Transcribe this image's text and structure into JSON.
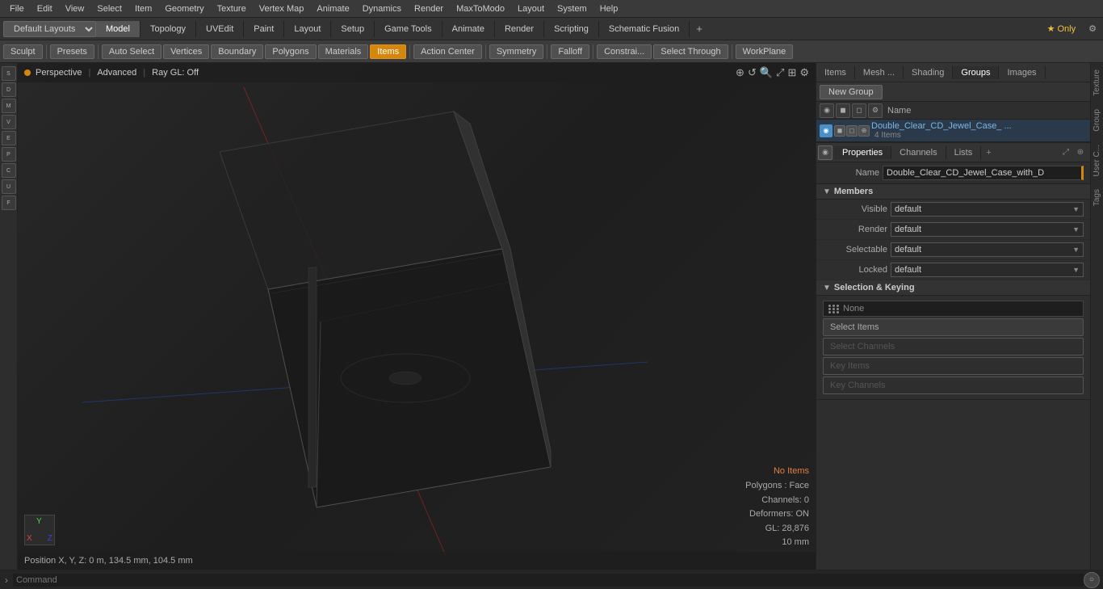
{
  "menu": {
    "items": [
      "File",
      "Edit",
      "View",
      "Select",
      "Item",
      "Geometry",
      "Texture",
      "Vertex Map",
      "Animate",
      "Dynamics",
      "Render",
      "MaxToModo",
      "Layout",
      "System",
      "Help"
    ]
  },
  "layout": {
    "dropdown_label": "Default Layouts ▾",
    "tabs": [
      "Model",
      "Topology",
      "UVEdit",
      "Paint",
      "Layout",
      "Setup",
      "Game Tools",
      "Animate",
      "Render",
      "Scripting",
      "Schematic Fusion"
    ],
    "active_tab": "Model",
    "star_label": "★ Only",
    "plus_label": "+"
  },
  "toolbar": {
    "sculpt_label": "Sculpt",
    "presets_label": "Presets",
    "auto_select_label": "Auto Select",
    "vertices_label": "Vertices",
    "boundary_label": "Boundary",
    "polygons_label": "Polygons",
    "materials_label": "Materials",
    "items_label": "Items",
    "action_center_label": "Action Center",
    "symmetry_label": "Symmetry",
    "falloff_label": "Falloff",
    "constrai_label": "Constrai...",
    "select_through_label": "Select Through",
    "workplane_label": "WorkPlane"
  },
  "viewport": {
    "perspective_label": "Perspective",
    "advanced_label": "Advanced",
    "ray_gl_label": "Ray GL: Off",
    "status": {
      "no_items": "No Items",
      "polygons": "Polygons : Face",
      "channels": "Channels: 0",
      "deformers": "Deformers: ON",
      "gl": "GL: 28,876",
      "size": "10 mm"
    },
    "position_label": "Position X, Y, Z:  0 m, 134.5 mm, 104.5 mm"
  },
  "right_panel": {
    "tabs": [
      "Items",
      "Mesh ...",
      "Shading",
      "Groups",
      "Images"
    ],
    "active_tab": "Groups",
    "new_group_label": "New Group",
    "groups_col_name": "Name",
    "group_item": {
      "name": "Double_Clear_CD_Jewel_Case_ ...",
      "count": "4 Items"
    },
    "props": {
      "tabs": [
        "Properties",
        "Channels",
        "Lists"
      ],
      "active_tab": "Properties",
      "plus_label": "+",
      "name_label": "Name",
      "name_value": "Double_Clear_CD_Jewel_Case_with_D",
      "members_section": "Members",
      "visible_label": "Visible",
      "visible_value": "default",
      "render_label": "Render",
      "render_value": "default",
      "selectable_label": "Selectable",
      "selectable_value": "default",
      "locked_label": "Locked",
      "locked_value": "default",
      "sel_keying_section": "Selection & Keying",
      "sel_none_label": "None",
      "select_items_label": "Select Items",
      "select_channels_label": "Select Channels",
      "key_items_label": "Key Items",
      "key_channels_label": "Key Channels"
    }
  },
  "bottom_bar": {
    "command_placeholder": "Command",
    "arrow_label": "›"
  },
  "far_right": {
    "labels": [
      "Texture",
      "Group",
      "User C...",
      "Tags"
    ]
  }
}
